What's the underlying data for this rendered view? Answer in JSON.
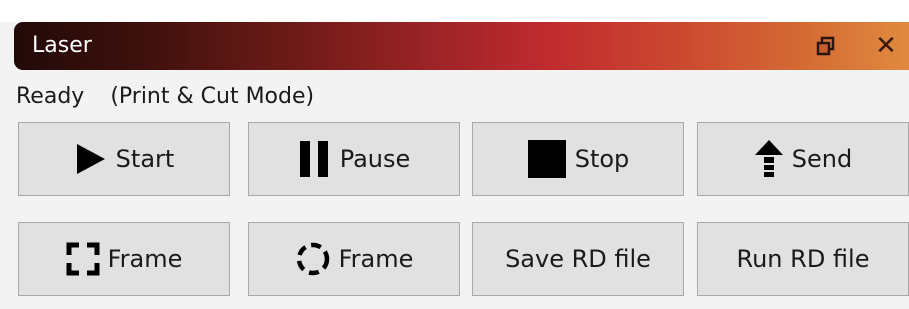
{
  "window": {
    "title": "Laser",
    "restore_icon": "restore-icon",
    "close_icon": "close-icon"
  },
  "status": {
    "state": "Ready",
    "mode": "(Print & Cut Mode)"
  },
  "buttons": {
    "start": {
      "label": "Start",
      "icon": "play-icon"
    },
    "pause": {
      "label": "Pause",
      "icon": "pause-icon"
    },
    "stop": {
      "label": "Stop",
      "icon": "stop-icon"
    },
    "send": {
      "label": "Send",
      "icon": "upload-arrow-icon"
    },
    "frame_square": {
      "label": "Frame",
      "icon": "square-frame-icon"
    },
    "frame_circle": {
      "label": "Frame",
      "icon": "circle-frame-icon"
    },
    "save_rd": {
      "label": "Save RD file"
    },
    "run_rd": {
      "label": "Run RD file"
    }
  },
  "colors": {
    "title_gradient_start": "#220a08",
    "title_gradient_mid": "#c02b2f",
    "title_gradient_end": "#e08a3f",
    "button_bg": "#e1e1e1"
  }
}
